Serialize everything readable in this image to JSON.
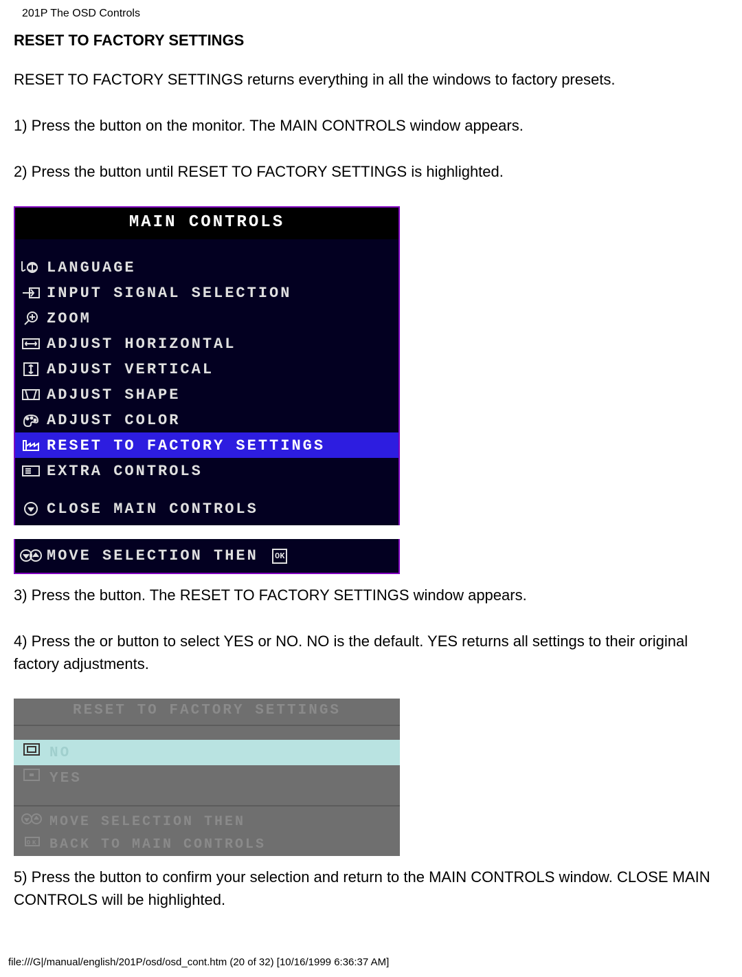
{
  "header": "201P The OSD Controls",
  "section_title": "RESET TO FACTORY SETTINGS",
  "intro": "RESET TO FACTORY SETTINGS returns everything in all the windows to factory presets.",
  "step1": "1) Press the        button on the monitor. The MAIN CONTROLS window appears.",
  "step2": "2) Press the        button until RESET TO FACTORY SETTINGS is highlighted.",
  "step3": "3) Press the        button. The RESET TO FACTORY SETTINGS window appears.",
  "step4": "4) Press the        or        button to select YES or NO. NO is the default. YES returns all settings to their original factory adjustments.",
  "step5": "5) Press the         button to confirm your selection and return to the MAIN CONTROLS window. CLOSE MAIN CONTROLS will be highlighted.",
  "osd1": {
    "title": "MAIN CONTROLS",
    "items": [
      "LANGUAGE",
      "INPUT SIGNAL SELECTION",
      "ZOOM",
      "ADJUST HORIZONTAL",
      "ADJUST VERTICAL",
      "ADJUST SHAPE",
      "ADJUST COLOR",
      "RESET TO FACTORY SETTINGS",
      "EXTRA CONTROLS"
    ],
    "close": "CLOSE MAIN CONTROLS",
    "footer": "MOVE SELECTION THEN",
    "ok": "OK"
  },
  "osd2": {
    "title": "RESET TO FACTORY SETTINGS",
    "no": "NO",
    "yes": "YES",
    "foot1": "MOVE SELECTION THEN",
    "foot2": "BACK TO MAIN CONTROLS"
  },
  "footer": "file:///G|/manual/english/201P/osd/osd_cont.htm (20 of 32) [10/16/1999 6:36:37 AM]"
}
